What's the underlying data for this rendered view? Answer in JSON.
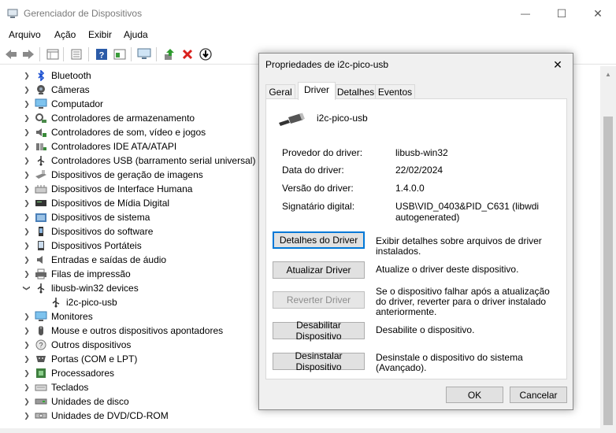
{
  "window": {
    "title": "Gerenciador de Dispositivos",
    "minimize": "—",
    "maximize": "☐",
    "close": "✕"
  },
  "menu": [
    "Arquivo",
    "Ação",
    "Exibir",
    "Ajuda"
  ],
  "toolbar_icons": [
    "back-arrow-icon",
    "forward-arrow-icon",
    "properties-grid-icon",
    "devices-icon",
    "help-icon",
    "view-icon",
    "monitor-icon",
    "update-driver-icon",
    "uninstall-x-icon",
    "scan-down-icon"
  ],
  "tree": [
    {
      "label": "Bluetooth",
      "icon": "bluetooth-icon",
      "expanded": false
    },
    {
      "label": "Câmeras",
      "icon": "camera-icon",
      "expanded": false
    },
    {
      "label": "Computador",
      "icon": "computer-icon",
      "expanded": false
    },
    {
      "label": "Controladores de armazenamento",
      "icon": "storage-controller-icon",
      "expanded": false
    },
    {
      "label": "Controladores de som, vídeo e jogos",
      "icon": "sound-icon",
      "expanded": false
    },
    {
      "label": "Controladores IDE ATA/ATAPI",
      "icon": "ide-icon",
      "expanded": false
    },
    {
      "label": "Controladores USB (barramento serial universal)",
      "icon": "usb-icon",
      "expanded": false
    },
    {
      "label": "Dispositivos de geração de imagens",
      "icon": "imaging-icon",
      "expanded": false
    },
    {
      "label": "Dispositivos de Interface Humana",
      "icon": "hid-icon",
      "expanded": false
    },
    {
      "label": "Dispositivos de Mídia Digital",
      "icon": "media-icon",
      "expanded": false
    },
    {
      "label": "Dispositivos de sistema",
      "icon": "system-folder-icon",
      "expanded": false
    },
    {
      "label": "Dispositivos do software",
      "icon": "software-device-icon",
      "expanded": false
    },
    {
      "label": "Dispositivos Portáteis",
      "icon": "portable-icon",
      "expanded": false
    },
    {
      "label": "Entradas e saídas de áudio",
      "icon": "audio-icon",
      "expanded": false
    },
    {
      "label": "Filas de impressão",
      "icon": "printer-icon",
      "expanded": false
    },
    {
      "label": "libusb-win32 devices",
      "icon": "libusb-icon",
      "expanded": true
    },
    {
      "label": "i2c-pico-usb",
      "icon": "libusb-device-icon",
      "child": true
    },
    {
      "label": "Monitores",
      "icon": "monitor-icon",
      "expanded": false
    },
    {
      "label": "Mouse e outros dispositivos apontadores",
      "icon": "mouse-icon",
      "expanded": false
    },
    {
      "label": "Outros dispositivos",
      "icon": "unknown-device-icon",
      "expanded": false
    },
    {
      "label": "Portas (COM e LPT)",
      "icon": "port-icon",
      "expanded": false
    },
    {
      "label": "Processadores",
      "icon": "processor-icon",
      "expanded": false
    },
    {
      "label": "Teclados",
      "icon": "keyboard-icon",
      "expanded": false
    },
    {
      "label": "Unidades de disco",
      "icon": "disk-icon",
      "expanded": false
    },
    {
      "label": "Unidades de DVD/CD-ROM",
      "icon": "dvd-icon",
      "expanded": false
    }
  ],
  "dialog": {
    "title": "Propriedades de i2c-pico-usb",
    "close": "✕",
    "tabs": [
      "Geral",
      "Driver",
      "Detalhes",
      "Eventos"
    ],
    "active_tab": "Driver",
    "device_name": "i2c-pico-usb",
    "properties": [
      {
        "label": "Provedor do driver:",
        "value": "libusb-win32"
      },
      {
        "label": "Data do driver:",
        "value": "22/02/2024"
      },
      {
        "label": "Versão do driver:",
        "value": "1.4.0.0"
      },
      {
        "label": "Signatário digital:",
        "value": "USB\\VID_0403&PID_C631 (libwdi autogenerated)"
      }
    ],
    "actions": [
      {
        "label": "Detalhes do Driver",
        "desc": "Exibir detalhes sobre arquivos de driver instalados.",
        "enabled": true
      },
      {
        "label": "Atualizar Driver",
        "desc": "Atualize o driver deste dispositivo.",
        "enabled": true
      },
      {
        "label": "Reverter Driver",
        "desc": "Se o dispositivo falhar após a atualização do driver, reverter para o driver instalado anteriormente.",
        "enabled": false
      },
      {
        "label": "Desabilitar Dispositivo",
        "desc": "Desabilite o dispositivo.",
        "enabled": true
      },
      {
        "label": "Desinstalar Dispositivo",
        "desc": "Desinstale o dispositivo do sistema (Avançado).",
        "enabled": true
      }
    ],
    "ok": "OK",
    "cancel": "Cancelar"
  }
}
